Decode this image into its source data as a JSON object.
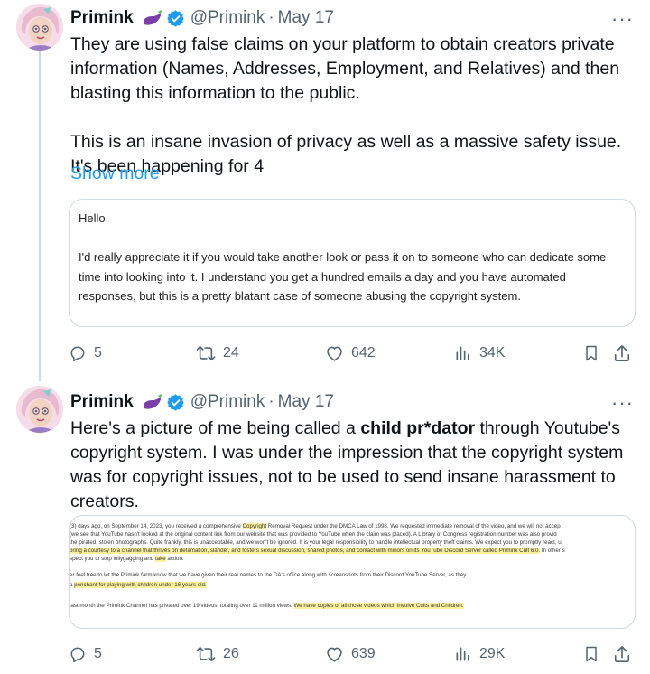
{
  "colors": {
    "link": "#1d9bf0",
    "muted": "#536471",
    "verified": "#1d9bf0",
    "highlight": "#fbef9a"
  },
  "tweets": [
    {
      "name": "Primink",
      "handle": "@Primink",
      "date": "May 17",
      "more_icon": "more-horizontal-icon",
      "paragraphs": [
        "They are using false claims on your platform to obtain creators private information (Names, Addresses, Employment, and Relatives) and then blasting this information to the public.",
        "This is an insane invasion of privacy as well as a massive safety issue. It's been happening for 4"
      ],
      "show_more": "Show more",
      "email": {
        "greeting": "Hello,",
        "body": "I'd really appreciate it if you would take another look or pass it on to someone who can dedicate some time into looking into it. I understand you get a hundred emails a day and you have automated responses, but this is a pretty blatant case of someone abusing the copyright system."
      },
      "actions": {
        "replies": "5",
        "reposts": "24",
        "likes": "642",
        "views": "34K"
      }
    },
    {
      "name": "Primink",
      "handle": "@Primink",
      "date": "May 17",
      "text_before": "Here's a picture of me being called a ",
      "text_bold": "child pr*dator",
      "text_after": " through Youtube's copyright system. I was under the impression that the copyright system was for copyright issues, not to be used to send insane harassment to creators.",
      "document": {
        "l1_a": "(3) days ago, on September 14, 2023, you received a comprehensive ",
        "l1_hl": "Copyright",
        "l1_b": " Removal Request under the DMCA Law of 1998. We requested immediate removal of the video, and we will not accep",
        "l2": "(we see that YouTube hasn't looked at the original content link from our website that was provided to YouTube when the claim was placed). A Library of Congress registration number was also provid",
        "l3": "the pirated, stolen photographs. Quite frankly, this is unacceptable, and we won't be ignored. It is your legal responsibility to handle intellectual property theft claims. We expect you to promptly react, u",
        "l4_hl": "bring a courtesy to a channel that thrives on defamation, slander, and fosters sexual discussion, shared photos, and contact with minors on its YouTube Discord Server called Primink Cult 6.0.",
        "l4_b": " In other s",
        "l5_a": "spect you to stop lollygagging and ",
        "l5_hl": "take",
        "l5_b": " action.",
        "l6": "er feel free to let the Primink farm know that we have given their real names to the DA's office along with screenshots from their Discord YouTube Server, as they",
        "l7_a": "a ",
        "l7_hl": "penchant for playing with children under 16 years old.",
        "l8_a": "last month the Primink Channel has privated over 19 videos, totaling over 11 million views. ",
        "l8_hl": "We have copies of all those videos which involve Cults and Children."
      },
      "actions": {
        "replies": "5",
        "reposts": "26",
        "likes": "639",
        "views": "29K"
      }
    }
  ]
}
